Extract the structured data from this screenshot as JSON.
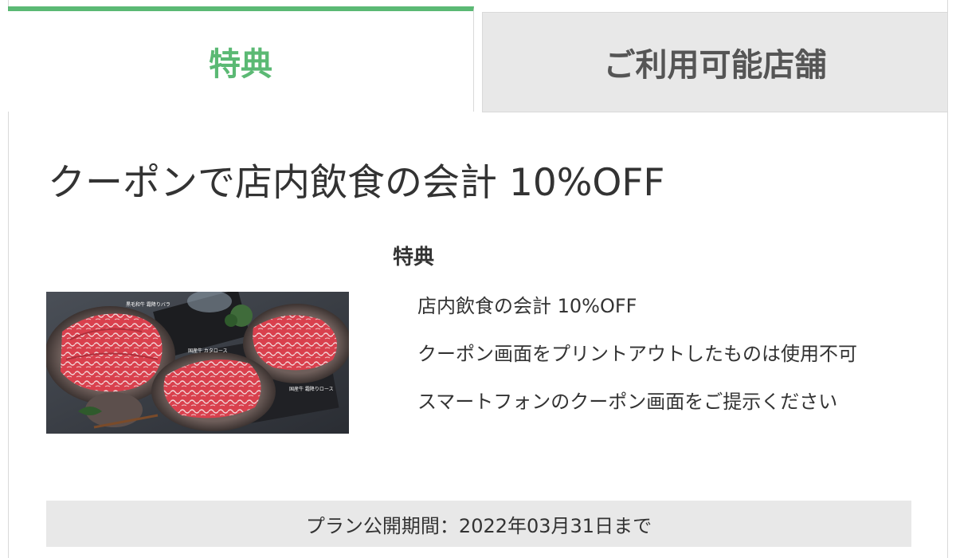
{
  "tabs": [
    {
      "label": "特典",
      "active": true
    },
    {
      "label": "ご利用可能店舗",
      "active": false
    }
  ],
  "coupon": {
    "title": "クーポンで店内飲食の会計 10%OFF",
    "section_heading": "特典",
    "benefits": [
      "店内飲食の会計 10%OFF",
      "クーポン画面をプリントアウトしたものは使用不可",
      "スマートフォンのクーポン画面をご提示ください"
    ],
    "image_captions": [
      "黒毛和牛 霜降りバラ",
      "国産牛 カタロース",
      "国産牛 霜降りロース"
    ]
  },
  "period": {
    "text": "プラン公開期間：2022年03月31日まで"
  },
  "colors": {
    "accent": "#5bb974",
    "inactive_tab_bg": "#e8e8e8",
    "text": "#333333"
  }
}
